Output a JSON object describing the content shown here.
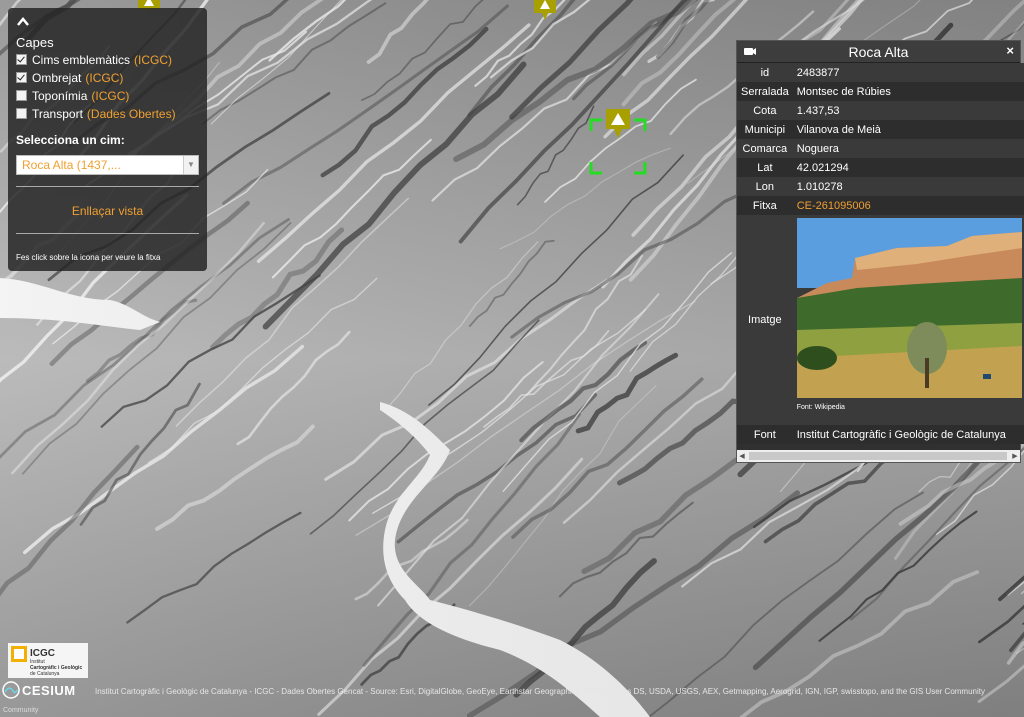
{
  "layers_panel": {
    "title": "Capes",
    "layers": [
      {
        "name": "Cims emblemàtics",
        "source": "(ICGC)",
        "checked": true
      },
      {
        "name": "Ombrejat",
        "source": "(ICGC)",
        "checked": true
      },
      {
        "name": "Toponímia",
        "source": "(ICGC)",
        "checked": false
      },
      {
        "name": "Transport",
        "source": "(Dades Obertes)",
        "checked": false
      }
    ],
    "select_label": "Selecciona un cim:",
    "select_value": "Roca Alta (1437,...",
    "link_button": "Enllaçar vista",
    "hint": "Fes click sobre la icona per veure la fitxa"
  },
  "info_box": {
    "title": "Roca Alta",
    "close_label": "×",
    "rows": [
      {
        "key": "id",
        "value": "2483877"
      },
      {
        "key": "Serralada",
        "value": "Montsec de Rúbies"
      },
      {
        "key": "Cota",
        "value": "1.437,53"
      },
      {
        "key": "Municipi",
        "value": "Vilanova de Meià"
      },
      {
        "key": "Comarca",
        "value": "Noguera"
      },
      {
        "key": "Lat",
        "value": "42.021294"
      },
      {
        "key": "Lon",
        "value": "1.010278"
      },
      {
        "key": "Fitxa",
        "value": "CE-261095006"
      }
    ],
    "image_key": "Imatge",
    "image_caption": "Font: Wikipedia",
    "font_key": "Font",
    "font_value": "Institut Cartogràfic i Geològic de Catalunya"
  },
  "logos": {
    "icgc_name": "ICGC",
    "icgc_sub1": "Institut",
    "icgc_sub2": "Cartogràfic i Geològic",
    "icgc_sub3": "de Catalunya",
    "cesium": "CESIUM"
  },
  "credits": "Institut Cartogràfic i Geològic de Catalunya - ICGC - Dades Obertes Gencat - Source: Esri, DigitalGlobe, GeoEye, Earthstar Geographics, CNES/Airbus DS, USDA, USGS, AEX, Getmapping, Aerogrid, IGN, IGP, swisstopo, and the GIS User Community",
  "community": "Community",
  "colors": {
    "accent": "#f0a030",
    "panel_bg": "#262626",
    "marker": "#a8a000",
    "selection": "#22dd22"
  }
}
